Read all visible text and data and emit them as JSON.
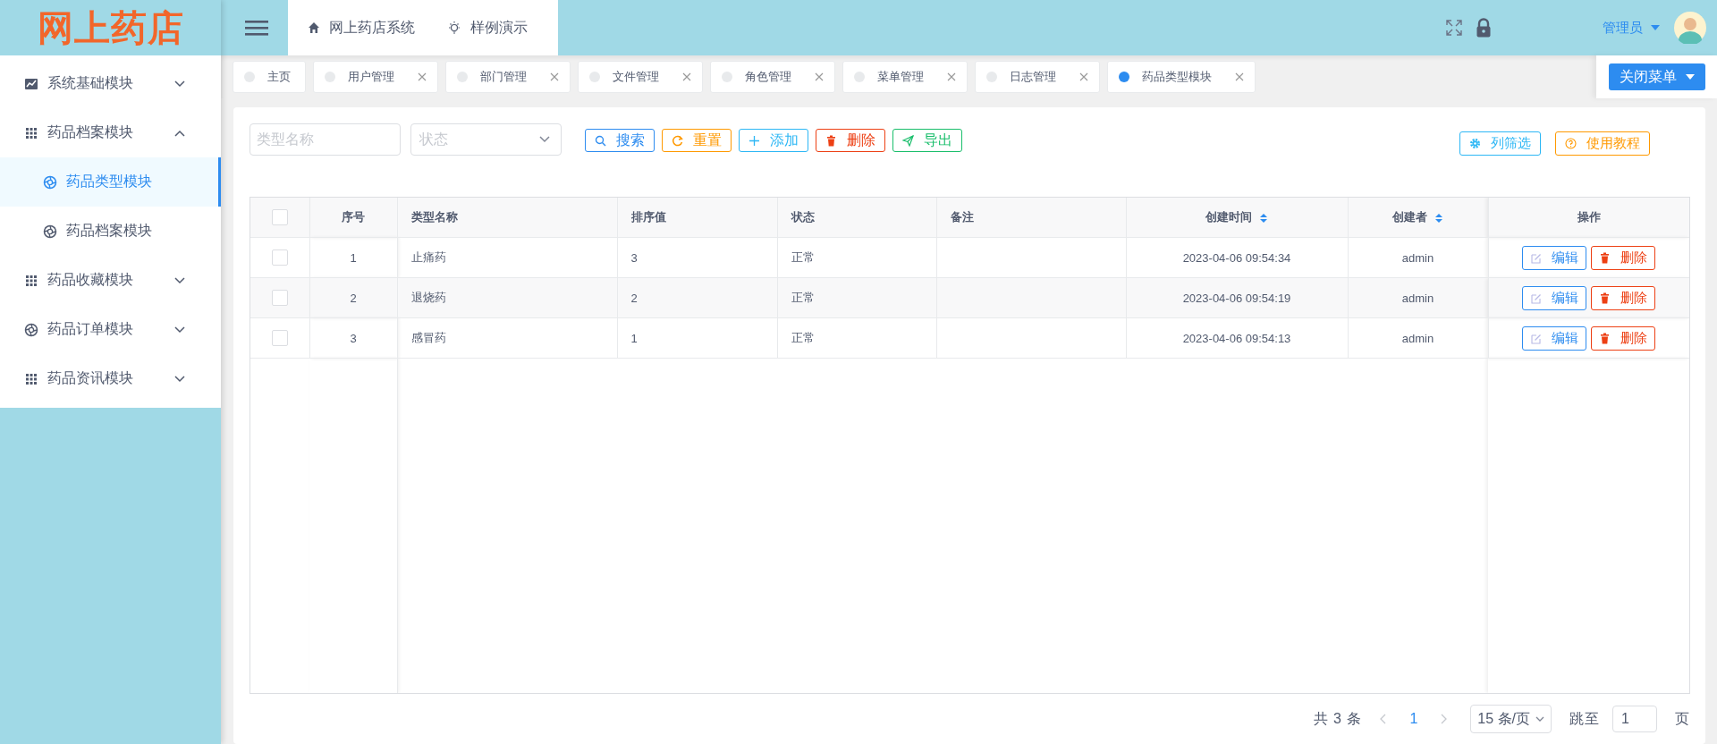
{
  "logo": {
    "text": "网上药店"
  },
  "header": {
    "nav": [
      {
        "kind": "home",
        "label": "网上药店系统"
      },
      {
        "kind": "bulb",
        "label": "样例演示"
      }
    ],
    "user": "管理员"
  },
  "sidebar": {
    "items": [
      {
        "kind": "chart",
        "label": "系统基础模块",
        "expanded": false,
        "selected": false
      },
      {
        "kind": "grid",
        "label": "药品档案模块",
        "expanded": true,
        "selected": false,
        "children": [
          {
            "kind": "aperture",
            "label": "药品类型模块",
            "selected": true
          },
          {
            "kind": "aperture",
            "label": "药品档案模块",
            "selected": false
          }
        ]
      },
      {
        "kind": "grid",
        "label": "药品收藏模块",
        "expanded": false,
        "selected": false
      },
      {
        "kind": "aperture",
        "label": "药品订单模块",
        "expanded": false,
        "selected": false
      },
      {
        "kind": "grid",
        "label": "药品资讯模块",
        "expanded": false,
        "selected": false
      }
    ]
  },
  "tabs": [
    {
      "label": "主页",
      "selected": false,
      "closable": false
    },
    {
      "label": "用户管理",
      "selected": false,
      "closable": true
    },
    {
      "label": "部门管理",
      "selected": false,
      "closable": true
    },
    {
      "label": "文件管理",
      "selected": false,
      "closable": true
    },
    {
      "label": "角色管理",
      "selected": false,
      "closable": true
    },
    {
      "label": "菜单管理",
      "selected": false,
      "closable": true
    },
    {
      "label": "日志管理",
      "selected": false,
      "closable": true
    },
    {
      "label": "药品类型模块",
      "selected": true,
      "closable": true
    }
  ],
  "close_menu": "关闭菜单",
  "filters": {
    "name": {
      "placeholder": "类型名称"
    },
    "status": {
      "placeholder": "状态"
    }
  },
  "toolbar": [
    {
      "kind": "search",
      "label": "搜索"
    },
    {
      "kind": "reset",
      "label": "重置"
    },
    {
      "kind": "add",
      "label": "添加"
    },
    {
      "kind": "delete",
      "label": "删除"
    },
    {
      "kind": "export",
      "label": "导出"
    }
  ],
  "toolbar_right": [
    {
      "kind": "columns",
      "label": "列筛选"
    },
    {
      "kind": "help",
      "label": "使用教程"
    }
  ],
  "table": {
    "all_checked": false,
    "columns": [
      {
        "label": "序号",
        "sortable": false
      },
      {
        "label": "类型名称",
        "sortable": false
      },
      {
        "label": "排序值",
        "sortable": false
      },
      {
        "label": "状态",
        "sortable": false
      },
      {
        "label": "备注",
        "sortable": false
      },
      {
        "label": "创建时间",
        "sortable": true
      },
      {
        "label": "创建者",
        "sortable": true
      },
      {
        "label": "操作",
        "sortable": false
      }
    ],
    "rows": [
      {
        "checked": false,
        "cells": [
          "1",
          "止痛药",
          "3",
          "正常",
          "",
          "2023-04-06 09:54:34",
          "admin"
        ],
        "actions": [
          "编辑",
          "删除"
        ]
      },
      {
        "checked": false,
        "cells": [
          "2",
          "退烧药",
          "2",
          "正常",
          "",
          "2023-04-06 09:54:19",
          "admin"
        ],
        "actions": [
          "编辑",
          "删除"
        ]
      },
      {
        "checked": false,
        "cells": [
          "3",
          "感冒药",
          "1",
          "正常",
          "",
          "2023-04-06 09:54:13",
          "admin"
        ],
        "actions": [
          "编辑",
          "删除"
        ]
      }
    ]
  },
  "pagination": {
    "total": "共 3 条",
    "pages": [
      {
        "label": "1",
        "selected": true
      }
    ],
    "page_size": "15 条/页",
    "jump_label": "跳至",
    "jump_value": "1",
    "page_unit": "页"
  }
}
